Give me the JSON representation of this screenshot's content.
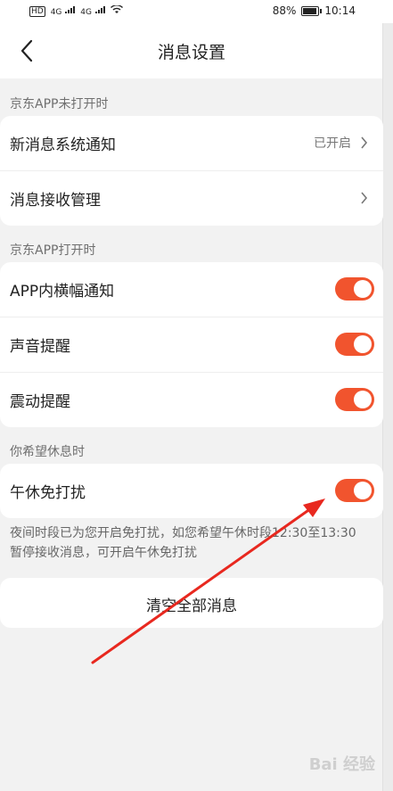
{
  "status_bar": {
    "left_icons": [
      "HD",
      "4G",
      "4G"
    ],
    "battery": "88%",
    "time": "10:14"
  },
  "header": {
    "title": "消息设置"
  },
  "sections": [
    {
      "label": "京东APP未打开时",
      "rows": [
        {
          "label": "新消息系统通知",
          "value": "已开启",
          "chevron": true
        },
        {
          "label": "消息接收管理",
          "chevron": true
        }
      ]
    },
    {
      "label": "京东APP打开时",
      "rows": [
        {
          "label": "APP内横幅通知",
          "toggle": true
        },
        {
          "label": "声音提醒",
          "toggle": true
        },
        {
          "label": "震动提醒",
          "toggle": true
        }
      ]
    },
    {
      "label": "你希望休息时",
      "rows": [
        {
          "label": "午休免打扰",
          "toggle": true
        }
      ]
    }
  ],
  "notice_text": "夜间时段已为您开启免打扰，如您希望午休时段12:30至13:30暂停接收消息，可开启午休免打扰",
  "clear_button": "清空全部消息",
  "watermark": "Bai 经验",
  "colors": {
    "toggle_on": "#f1542e",
    "annotation_arrow": "#e8281f"
  }
}
